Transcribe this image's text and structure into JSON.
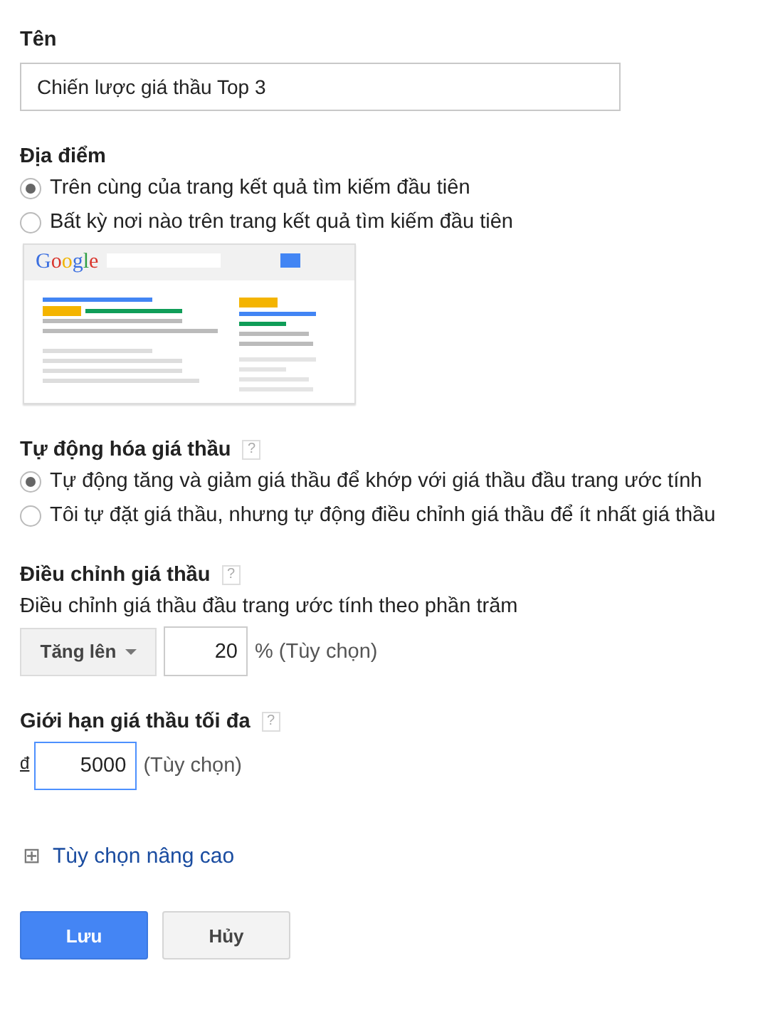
{
  "name": {
    "label": "Tên",
    "value": "Chiến lược giá thầu Top 3"
  },
  "location": {
    "label": "Địa điểm",
    "options": [
      {
        "label": "Trên cùng của trang kết quả tìm kiếm đầu tiên",
        "selected": true
      },
      {
        "label": "Bất kỳ nơi nào trên trang kết quả tìm kiếm đầu tiên",
        "selected": false
      }
    ],
    "preview": {
      "logo": "Google"
    }
  },
  "automation": {
    "label": "Tự động hóa giá thầu",
    "help": "?",
    "options": [
      {
        "label": "Tự động tăng và giảm giá thầu để khớp với giá thầu đầu trang ước tính",
        "selected": true
      },
      {
        "label": "Tôi tự đặt giá thầu, nhưng tự động điều chỉnh giá thầu để ít nhất giá thầu",
        "selected": false
      }
    ]
  },
  "adjustment": {
    "label": "Điều chỉnh giá thầu",
    "help": "?",
    "description": "Điều chỉnh giá thầu đầu trang ước tính theo phần trăm",
    "direction": "Tăng lên",
    "value": "20",
    "unit": "% (Tùy chọn)"
  },
  "max_bid": {
    "label": "Giới hạn giá thầu tối đa",
    "help": "?",
    "currency": "đ",
    "value": "5000",
    "note": "(Tùy chọn)",
    "focused": true
  },
  "advanced": {
    "icon": "⊞",
    "label": "Tùy chọn nâng cao"
  },
  "buttons": [
    {
      "label": "Lưu",
      "kind": "primary"
    },
    {
      "label": "Hủy",
      "kind": "secondary"
    }
  ]
}
